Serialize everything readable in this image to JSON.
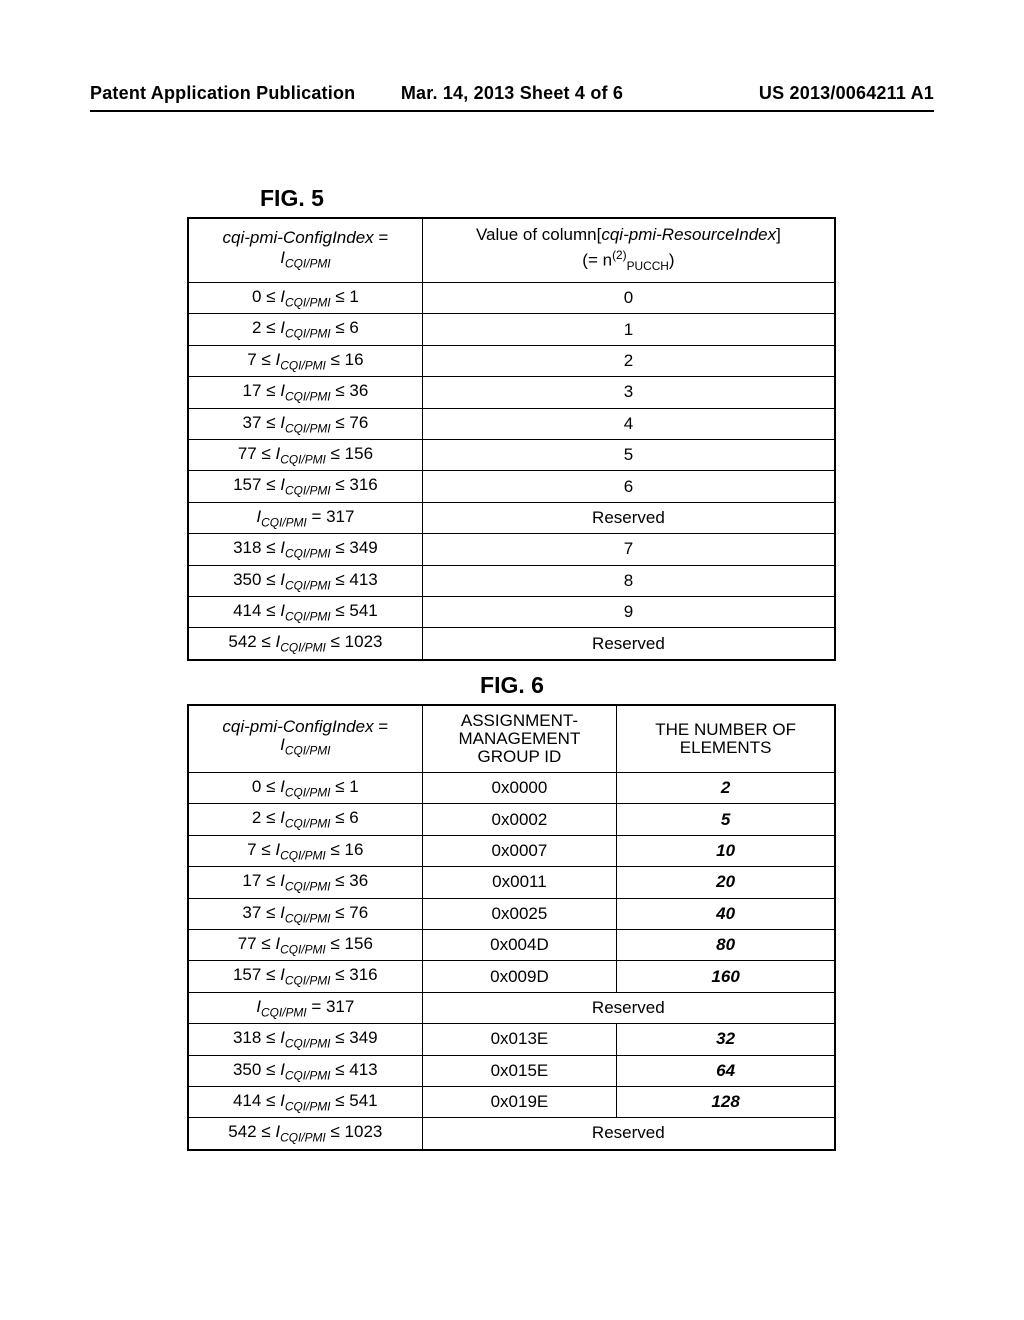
{
  "header": {
    "left": "Patent Application Publication",
    "center": "Mar. 14, 2013  Sheet 4 of 6",
    "right": "US 2013/0064211 A1"
  },
  "fig5": {
    "caption": "FIG. 5",
    "col_headers": {
      "c1": "cqi-pmi-ConfigIndex = I_CQI/PMI",
      "c2": "Value of column [cqi-pmi-ResourceIndex] (= n^(2)_PUCCH)"
    },
    "rows": [
      {
        "range": "0 ≤ I_CQI/PMI ≤ 1",
        "value": "0"
      },
      {
        "range": "2 ≤ I_CQI/PMI ≤ 6",
        "value": "1"
      },
      {
        "range": "7 ≤ I_CQI/PMI ≤ 16",
        "value": "2"
      },
      {
        "range": "17 ≤ I_CQI/PMI ≤ 36",
        "value": "3"
      },
      {
        "range": "37 ≤ I_CQI/PMI ≤ 76",
        "value": "4"
      },
      {
        "range": "77 ≤ I_CQI/PMI ≤ 156",
        "value": "5"
      },
      {
        "range": "157 ≤ I_CQI/PMI ≤ 316",
        "value": "6"
      },
      {
        "range": "I_CQI/PMI = 317",
        "value": "Reserved"
      },
      {
        "range": "318 ≤ I_CQI/PMI ≤ 349",
        "value": "7"
      },
      {
        "range": "350 ≤ I_CQI/PMI ≤ 413",
        "value": "8"
      },
      {
        "range": "414 ≤ I_CQI/PMI ≤ 541",
        "value": "9"
      },
      {
        "range": "542 ≤ I_CQI/PMI ≤ 1023",
        "value": "Reserved"
      }
    ]
  },
  "fig6": {
    "caption": "FIG. 6",
    "col_headers": {
      "d1": "cqi-pmi-ConfigIndex = I_CQI/PMI",
      "d2": "ASSIGNMENT-MANAGEMENT GROUP ID",
      "d3": "THE NUMBER OF ELEMENTS"
    },
    "rows": [
      {
        "range": "0 ≤ I_CQI/PMI ≤ 1",
        "group_id": "0x0000",
        "elements": "2"
      },
      {
        "range": "2 ≤ I_CQI/PMI ≤ 6",
        "group_id": "0x0002",
        "elements": "5"
      },
      {
        "range": "7 ≤ I_CQI/PMI ≤ 16",
        "group_id": "0x0007",
        "elements": "10"
      },
      {
        "range": "17 ≤ I_CQI/PMI ≤ 36",
        "group_id": "0x0011",
        "elements": "20"
      },
      {
        "range": "37 ≤ I_CQI/PMI ≤ 76",
        "group_id": "0x0025",
        "elements": "40"
      },
      {
        "range": "77 ≤ I_CQI/PMI ≤ 156",
        "group_id": "0x004D",
        "elements": "80"
      },
      {
        "range": "157 ≤ I_CQI/PMI ≤ 316",
        "group_id": "0x009D",
        "elements": "160"
      },
      {
        "range": "I_CQI/PMI = 317",
        "reserved": "Reserved"
      },
      {
        "range": "318 ≤ I_CQI/PMI ≤ 349",
        "group_id": "0x013E",
        "elements": "32"
      },
      {
        "range": "350 ≤ I_CQI/PMI ≤ 413",
        "group_id": "0x015E",
        "elements": "64"
      },
      {
        "range": "414 ≤ I_CQI/PMI ≤ 541",
        "group_id": "0x019E",
        "elements": "128"
      },
      {
        "range": "542 ≤ I_CQI/PMI ≤ 1023",
        "reserved": "Reserved"
      }
    ]
  }
}
